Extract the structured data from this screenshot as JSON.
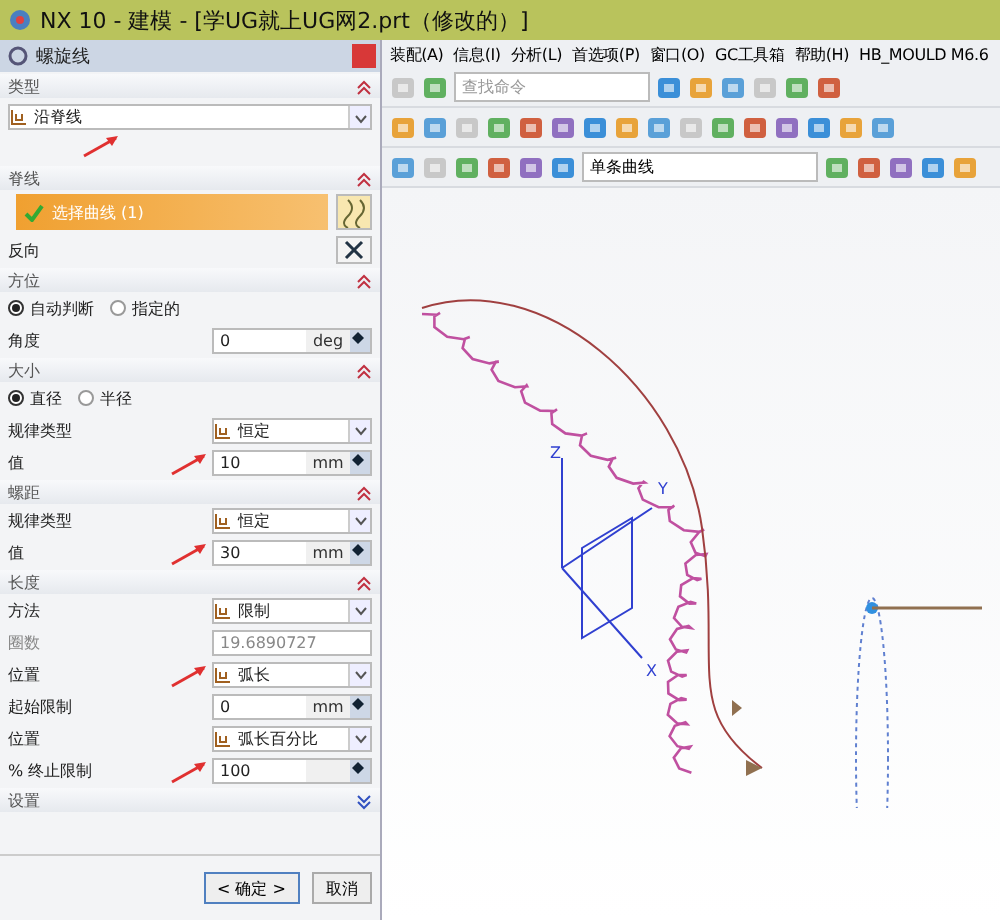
{
  "window": {
    "title": "NX 10 - 建模 - [学UG就上UG网2.prt（修改的）]"
  },
  "menu": [
    "装配(A)",
    "信息(I)",
    "分析(L)",
    "首选项(P)",
    "窗口(O)",
    "GC工具箱",
    "帮助(H)",
    "HB_MOULD M6.6"
  ],
  "toolbar": {
    "search_placeholder": "查找命令",
    "filter": "单条曲线"
  },
  "dialog": {
    "title": "螺旋线",
    "sections": [
      {
        "title": "类型",
        "expanded": true,
        "rows": [
          {
            "kind": "dropdown",
            "label": "",
            "value": "沿脊线",
            "arrow": true
          }
        ]
      },
      {
        "title": "脊线",
        "expanded": true,
        "rows": [
          {
            "kind": "select",
            "label": "选择曲线 (1)",
            "arrow": false
          },
          {
            "kind": "button",
            "label": "反向",
            "arrow": false
          }
        ]
      },
      {
        "title": "方位",
        "expanded": true,
        "rows": [
          {
            "kind": "radio",
            "options": [
              {
                "label": "自动判断",
                "selected": true
              },
              {
                "label": "指定的",
                "selected": false
              }
            ],
            "arrow": false
          },
          {
            "kind": "value",
            "label": "角度",
            "value": "0",
            "unit": "deg",
            "arrow": false
          }
        ]
      },
      {
        "title": "大小",
        "expanded": true,
        "rows": [
          {
            "kind": "radio",
            "options": [
              {
                "label": "直径",
                "selected": true
              },
              {
                "label": "半径",
                "selected": false
              }
            ],
            "arrow": false
          },
          {
            "kind": "dropdown",
            "label": "规律类型",
            "value": "恒定",
            "arrow": false
          },
          {
            "kind": "value",
            "label": "值",
            "value": "10",
            "unit": "mm",
            "arrow": true
          }
        ]
      },
      {
        "title": "螺距",
        "expanded": true,
        "rows": [
          {
            "kind": "dropdown",
            "label": "规律类型",
            "value": "恒定",
            "arrow": false
          },
          {
            "kind": "value",
            "label": "值",
            "value": "30",
            "unit": "mm",
            "arrow": true
          }
        ]
      },
      {
        "title": "长度",
        "expanded": true,
        "rows": [
          {
            "kind": "dropdown",
            "label": "方法",
            "value": "限制",
            "arrow": false
          },
          {
            "kind": "readonly",
            "label": "圈数",
            "value": "19.6890727",
            "arrow": false
          },
          {
            "kind": "dropdown",
            "label": "位置",
            "value": "弧长",
            "arrow": true
          },
          {
            "kind": "value",
            "label": "起始限制",
            "value": "0",
            "unit": "mm",
            "arrow": false
          },
          {
            "kind": "dropdown",
            "label": "位置",
            "value": "弧长百分比",
            "arrow": false
          },
          {
            "kind": "value",
            "label": "% 终止限制",
            "value": "100",
            "unit": "",
            "arrow": true
          }
        ]
      },
      {
        "title": "设置",
        "expanded": false
      }
    ],
    "buttons": [
      "< 确定 >",
      "取消"
    ]
  },
  "canvas": {
    "axes": [
      "Z",
      "Y",
      "X"
    ]
  }
}
